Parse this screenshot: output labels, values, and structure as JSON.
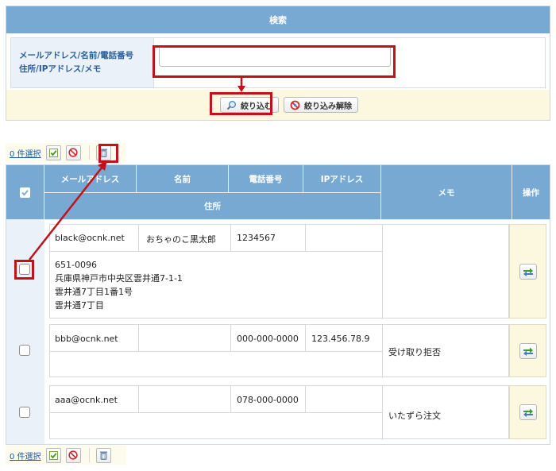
{
  "search": {
    "title": "検索",
    "label_line1": "メールアドレス/名前/電話番号",
    "label_line2": "住所/IPアドレス/メモ",
    "input_value": "",
    "input_placeholder": "",
    "filter_button": "絞り込む",
    "clear_button": "絞り込み解除"
  },
  "toolbar": {
    "selected_count": "0 件選択"
  },
  "table": {
    "headers": {
      "email": "メールアドレス",
      "name": "名前",
      "phone": "電話番号",
      "ip": "IPアドレス",
      "memo": "メモ",
      "action": "操作",
      "address": "住所"
    },
    "rows": [
      {
        "email": "black@ocnk.net",
        "name": "おちゃのこ黒太郎",
        "phone": "1234567",
        "ip": "",
        "memo": "",
        "address_lines": [
          "651-0096",
          "兵庫県神戸市中央区雲井通7-1-1",
          "雲井通7丁目1番1号",
          "雲井通7丁目"
        ]
      },
      {
        "email": "bbb@ocnk.net",
        "name": "",
        "phone": "000-000-0000",
        "ip": "123.456.78.9",
        "memo": "受け取り拒否",
        "address_lines": []
      },
      {
        "email": "aaa@ocnk.net",
        "name": "",
        "phone": "078-000-0000",
        "ip": "",
        "memo": "いたずら注文",
        "address_lines": []
      }
    ]
  },
  "colors": {
    "header_blue": "#77a9d3",
    "highlight_red": "#c1121a",
    "label_bg": "#eaf1f9",
    "footer_cream": "#fcf8e0"
  },
  "icons": {
    "filter": "magnifier-icon",
    "clear": "no-entry-icon",
    "select_all": "check-icon",
    "deselect": "prohibit-icon",
    "delete": "trash-icon",
    "edit": "edit-arrows-icon"
  }
}
